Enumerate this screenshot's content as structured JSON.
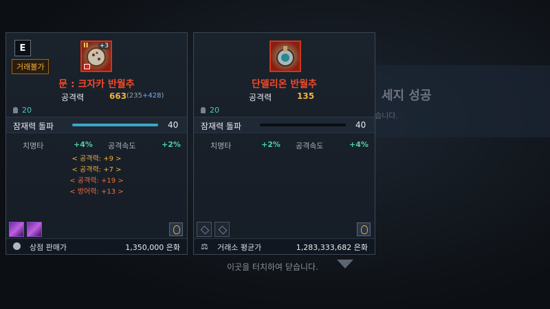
{
  "background": {
    "title": "세지 성공",
    "subtitle": "겠습니다.",
    "hint": "이곳을 터치하여 닫습니다."
  },
  "left_card": {
    "grade": "E",
    "trade_badge": "거래불가",
    "upgrade": "+3",
    "icon": "moon-pendant-icon",
    "name": "문 : 크자카 반월추",
    "attack_label": "공격력",
    "attack_value": "663",
    "attack_base": "235",
    "attack_bonus": "+428",
    "level": "20",
    "stage_label": "잠재력 돌파",
    "stage_value": "40",
    "stage_fill": 1.0,
    "crit_label": "치명타",
    "crit_value": "+4%",
    "speed_label": "공격속도",
    "speed_value": "+2%",
    "engravings": [
      {
        "text": "< 공격력: +9 >"
      },
      {
        "text": "< 공격력: +7 >"
      },
      {
        "text": "< 공격력: +19 >"
      },
      {
        "text": "< 방어력: +13 >"
      }
    ],
    "price_label": "상점 판매가",
    "price_value": "1,350,000 은화"
  },
  "right_card": {
    "icon": "pendant-icon",
    "name": "단델리온 반월추",
    "attack_label": "공격력",
    "attack_value": "135",
    "level": "20",
    "stage_label": "잠재력 돌파",
    "stage_value": "40",
    "stage_fill": 0.0,
    "crit_label": "치명타",
    "crit_value": "+2%",
    "speed_label": "공격속도",
    "speed_value": "+4%",
    "price_label": "거래소 평균가",
    "price_value": "1,283,333,682 은화"
  },
  "colors": {
    "name_red": "#f04a2a",
    "attack_gold": "#f0b040",
    "stat_green": "#4ed0a8",
    "stage_bar": "#3aa8c8"
  }
}
